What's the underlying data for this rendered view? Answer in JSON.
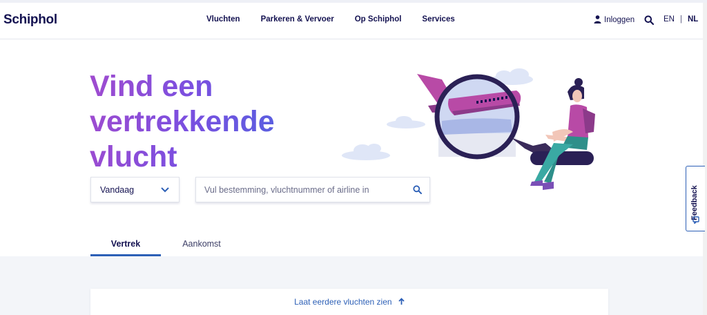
{
  "header": {
    "logo": "Schiphol",
    "nav": [
      "Vluchten",
      "Parkeren & Vervoer",
      "Op Schiphol",
      "Services"
    ],
    "login_label": "Inloggen",
    "lang": {
      "en": "EN",
      "separator": "|",
      "nl": "NL"
    }
  },
  "hero": {
    "title_lines": [
      "Vind een",
      "vertrekkende",
      "vlucht"
    ]
  },
  "search": {
    "date_value": "Vandaag",
    "placeholder": "Vul bestemming, vluchtnummer of airline in"
  },
  "tabs": [
    {
      "label": "Vertrek",
      "active": true
    },
    {
      "label": "Aankomst",
      "active": false
    }
  ],
  "results": {
    "earlier_label": "Laat eerdere vluchten zien"
  },
  "feedback": {
    "label": "Feedback"
  },
  "colors": {
    "brand_navy": "#141251",
    "accent_blue": "#2c5fb6",
    "gradient_purple": "#a04bcf",
    "gradient_blue": "#4a66e0",
    "content_bg": "#f3f5f9"
  },
  "icons": {
    "login": "person-icon",
    "search": "search-icon",
    "date_dropdown": "chevron-down-icon",
    "search_field": "magnifier-icon",
    "earlier": "arrow-up-icon",
    "feedback": "feedback-icon"
  }
}
